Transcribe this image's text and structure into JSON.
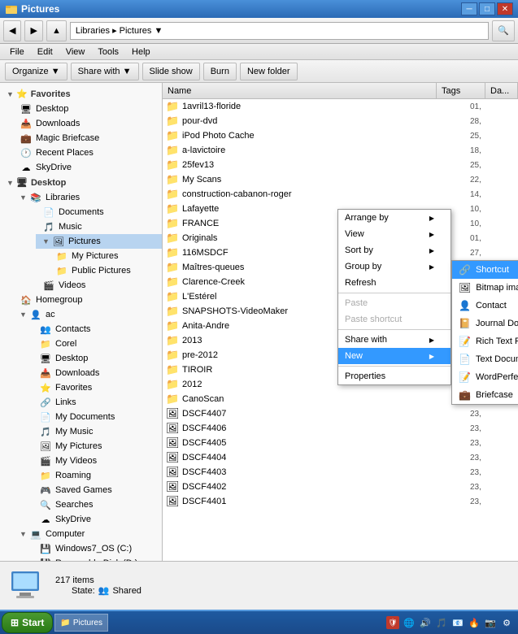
{
  "titleBar": {
    "title": "Pictures",
    "buttons": [
      "─",
      "□",
      "✕"
    ]
  },
  "navBar": {
    "backLabel": "◀",
    "forwardLabel": "▶",
    "upLabel": "▲",
    "addressPath": "Libraries ▸ Pictures ▼"
  },
  "menuBar": {
    "items": [
      "File",
      "Edit",
      "View",
      "Tools",
      "Help"
    ]
  },
  "toolbar": {
    "items": [
      "Organize ▼",
      "Share with ▼",
      "Slide show",
      "Burn",
      "New folder"
    ]
  },
  "fileListHeader": {
    "nameCol": "Name",
    "tagsCol": "Tags",
    "dateCol": "Da..."
  },
  "files": [
    {
      "name": "1avril13-floride",
      "type": "folder",
      "date": "01,"
    },
    {
      "name": "pour-dvd",
      "type": "folder",
      "date": "28,"
    },
    {
      "name": "iPod Photo Cache",
      "type": "folder",
      "date": "25,"
    },
    {
      "name": "a-lavictoire",
      "type": "folder",
      "date": "18,"
    },
    {
      "name": "25fev13",
      "type": "folder",
      "date": "25,"
    },
    {
      "name": "My Scans",
      "type": "folder",
      "date": "22,"
    },
    {
      "name": "construction-cabanon-roger",
      "type": "folder",
      "date": "14,"
    },
    {
      "name": "Lafayette",
      "type": "folder",
      "date": "10,"
    },
    {
      "name": "FRANCE",
      "type": "folder",
      "date": "10,"
    },
    {
      "name": "Originals",
      "type": "folder",
      "date": "01,"
    },
    {
      "name": "116MSDCF",
      "type": "folder",
      "date": "27,"
    },
    {
      "name": "Maîtres-queues",
      "type": "folder",
      "date": "25,"
    },
    {
      "name": "Clarence-Creek",
      "type": "folder",
      "date": "25,"
    },
    {
      "name": "L'Estérel",
      "type": "folder",
      "date": "25,"
    },
    {
      "name": "SNAPSHOTS-VideoMaker",
      "type": "folder",
      "date": "25,"
    },
    {
      "name": "Anita-Andre",
      "type": "folder",
      "date": "16,"
    },
    {
      "name": "2013",
      "type": "folder",
      "date": ""
    },
    {
      "name": "pre-2012",
      "type": "folder",
      "date": "16,"
    },
    {
      "name": "TIROIR",
      "type": "folder",
      "date": "16,"
    },
    {
      "name": "2012",
      "type": "folder",
      "date": ""
    },
    {
      "name": "CanoScan",
      "type": "folder",
      "date": ""
    },
    {
      "name": "DSCF4407",
      "type": "file",
      "date": "23,"
    },
    {
      "name": "DSCF4406",
      "type": "file",
      "date": "23,"
    },
    {
      "name": "DSCF4405",
      "type": "file",
      "date": "23,"
    },
    {
      "name": "DSCF4404",
      "type": "file",
      "date": "23,"
    },
    {
      "name": "DSCF4403",
      "type": "file",
      "date": "23,"
    },
    {
      "name": "DSCF4402",
      "type": "file",
      "date": "23,"
    },
    {
      "name": "DSCF4401",
      "type": "file",
      "date": "23,"
    }
  ],
  "contextMenu": {
    "items": [
      {
        "label": "Arrange by",
        "hasSub": true
      },
      {
        "label": "View",
        "hasSub": true
      },
      {
        "label": "Sort by",
        "hasSub": true
      },
      {
        "label": "Group by",
        "hasSub": true
      },
      {
        "label": "Refresh",
        "hasSub": false
      },
      {
        "separator": true
      },
      {
        "label": "Paste",
        "hasSub": false,
        "disabled": true
      },
      {
        "label": "Paste shortcut",
        "hasSub": false,
        "disabled": true
      },
      {
        "separator": true
      },
      {
        "label": "Share with",
        "hasSub": true
      },
      {
        "label": "New",
        "hasSub": true,
        "highlighted": true
      },
      {
        "separator": true
      },
      {
        "label": "Properties",
        "hasSub": false
      }
    ]
  },
  "submenuNew": {
    "items": [
      {
        "label": "Shortcut",
        "highlighted": true,
        "icon": "shortcut"
      },
      {
        "label": "Bitmap image",
        "icon": "bitmap"
      },
      {
        "label": "Contact",
        "icon": "contact"
      },
      {
        "label": "Journal Document",
        "icon": "journal"
      },
      {
        "label": "Rich Text Format",
        "icon": "rtf"
      },
      {
        "label": "Text Document",
        "icon": "text"
      },
      {
        "label": "WordPerfect 12 Document",
        "icon": "wp"
      },
      {
        "label": "Briefcase",
        "icon": "briefcase"
      }
    ]
  },
  "sidebar": {
    "sections": [
      {
        "header": "Favorites",
        "icon": "star",
        "items": [
          {
            "label": "Desktop",
            "icon": "desktop"
          },
          {
            "label": "Downloads",
            "icon": "downloads"
          },
          {
            "label": "Magic Briefcase",
            "icon": "briefcase"
          },
          {
            "label": "Recent Places",
            "icon": "recent"
          },
          {
            "label": "SkyDrive",
            "icon": "cloud"
          }
        ]
      },
      {
        "header": "Desktop",
        "icon": "desktop",
        "items": [
          {
            "label": "Libraries",
            "icon": "library",
            "expanded": true,
            "children": [
              {
                "label": "Documents",
                "icon": "documents"
              },
              {
                "label": "Music",
                "icon": "music"
              },
              {
                "label": "Pictures",
                "icon": "pictures",
                "selected": true,
                "children": [
                  {
                    "label": "My Pictures",
                    "icon": "folder"
                  },
                  {
                    "label": "Public Pictures",
                    "icon": "folder"
                  }
                ]
              },
              {
                "label": "Videos",
                "icon": "video"
              }
            ]
          },
          {
            "label": "Homegroup",
            "icon": "homegroup"
          },
          {
            "label": "ac",
            "icon": "user",
            "children": [
              {
                "label": "Contacts",
                "icon": "contacts"
              },
              {
                "label": "Corel",
                "icon": "folder"
              },
              {
                "label": "Desktop",
                "icon": "desktop"
              },
              {
                "label": "Downloads",
                "icon": "downloads"
              },
              {
                "label": "Favorites",
                "icon": "favorites"
              },
              {
                "label": "Links",
                "icon": "links"
              },
              {
                "label": "My Documents",
                "icon": "documents"
              },
              {
                "label": "My Music",
                "icon": "music"
              },
              {
                "label": "My Pictures",
                "icon": "pictures"
              },
              {
                "label": "My Videos",
                "icon": "video"
              },
              {
                "label": "Roaming",
                "icon": "folder"
              },
              {
                "label": "Saved Games",
                "icon": "folder"
              },
              {
                "label": "Searches",
                "icon": "search"
              },
              {
                "label": "SkyDrive",
                "icon": "cloud"
              }
            ]
          },
          {
            "label": "Computer",
            "icon": "computer",
            "children": [
              {
                "label": "Windows7_OS (C:)",
                "icon": "drive"
              },
              {
                "label": "Removable Disk (D:)",
                "icon": "drive"
              }
            ]
          }
        ]
      }
    ]
  },
  "statusBar": {
    "count": "217 items",
    "stateLabel": "State:",
    "stateValue": "Shared",
    "stateIcon": "shared"
  },
  "taskbar": {
    "startLabel": "Start",
    "apps": [],
    "time": "..."
  }
}
